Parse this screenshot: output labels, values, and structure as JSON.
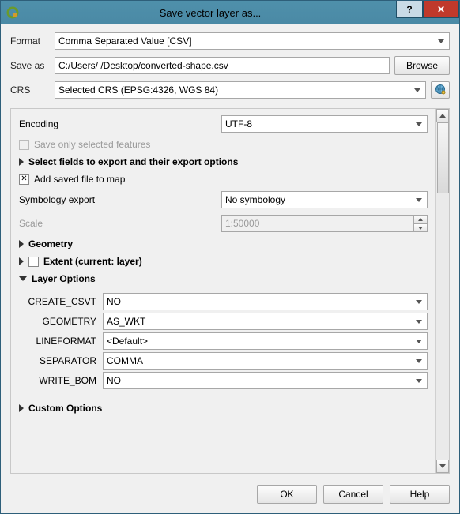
{
  "titlebar": {
    "title": "Save vector layer as...",
    "help": "?",
    "close": "✕"
  },
  "form": {
    "format_label": "Format",
    "format_value": "Comma Separated Value [CSV]",
    "saveas_label": "Save as",
    "saveas_value": "C:/Users/                               /Desktop/converted-shape.csv",
    "browse": "Browse",
    "crs_label": "CRS",
    "crs_value": "Selected CRS (EPSG:4326, WGS 84)"
  },
  "options": {
    "encoding_label": "Encoding",
    "encoding_value": "UTF-8",
    "save_selected": "Save only selected features",
    "select_fields": "Select fields to export and their export options",
    "add_to_map": "Add saved file to map",
    "symbology_label": "Symbology export",
    "symbology_value": "No symbology",
    "scale_label": "Scale",
    "scale_value": "1:50000",
    "geometry_section": "Geometry",
    "extent_section": "Extent (current: layer)",
    "layer_options": "Layer Options",
    "layer": {
      "create_csvt_label": "CREATE_CSVT",
      "create_csvt_value": "NO",
      "geometry_label": "GEOMETRY",
      "geometry_value": "AS_WKT",
      "lineformat_label": "LINEFORMAT",
      "lineformat_value": "<Default>",
      "separator_label": "SEPARATOR",
      "separator_value": "COMMA",
      "write_bom_label": "WRITE_BOM",
      "write_bom_value": "NO"
    },
    "custom_options": "Custom Options"
  },
  "footer": {
    "ok": "OK",
    "cancel": "Cancel",
    "help": "Help"
  }
}
